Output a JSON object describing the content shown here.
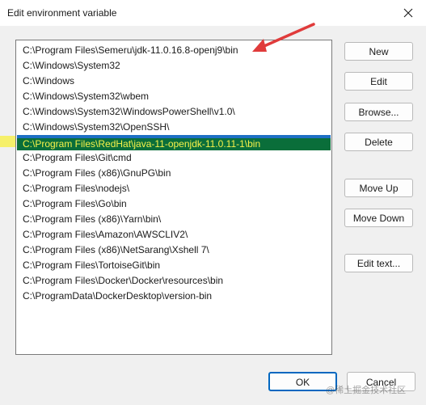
{
  "window": {
    "title": "Edit environment variable"
  },
  "list": {
    "items": [
      "C:\\Program Files\\Semeru\\jdk-11.0.16.8-openj9\\bin",
      "C:\\Windows\\System32",
      "C:\\Windows",
      "C:\\Windows\\System32\\wbem",
      "C:\\Windows\\System32\\WindowsPowerShell\\v1.0\\",
      "C:\\Windows\\System32\\OpenSSH\\",
      "C:\\Program Files\\RedHat\\java-11-openjdk-11.0.11-1\\bin",
      "C:\\Program Files\\Git\\cmd",
      "C:\\Program Files (x86)\\GnuPG\\bin",
      "C:\\Program Files\\nodejs\\",
      "C:\\Program Files\\Go\\bin",
      "C:\\Program Files (x86)\\Yarn\\bin\\",
      "C:\\Program Files\\Amazon\\AWSCLIV2\\",
      "C:\\Program Files (x86)\\NetSarang\\Xshell 7\\",
      "C:\\Program Files\\TortoiseGit\\bin",
      "C:\\Program Files\\Docker\\Docker\\resources\\bin",
      "C:\\ProgramData\\DockerDesktop\\version-bin"
    ],
    "selected_index": 6
  },
  "buttons": {
    "new": "New",
    "edit": "Edit",
    "browse": "Browse...",
    "delete": "Delete",
    "move_up": "Move Up",
    "move_down": "Move Down",
    "edit_text": "Edit text...",
    "ok": "OK",
    "cancel": "Cancel"
  },
  "watermark": "@稀土掘金技术社区",
  "colors": {
    "selection_bg": "#0a6e3a",
    "selection_text": "#f7f24a",
    "annotation_arrow": "#e03b3b",
    "highlight_marker": "#f6f06a"
  }
}
